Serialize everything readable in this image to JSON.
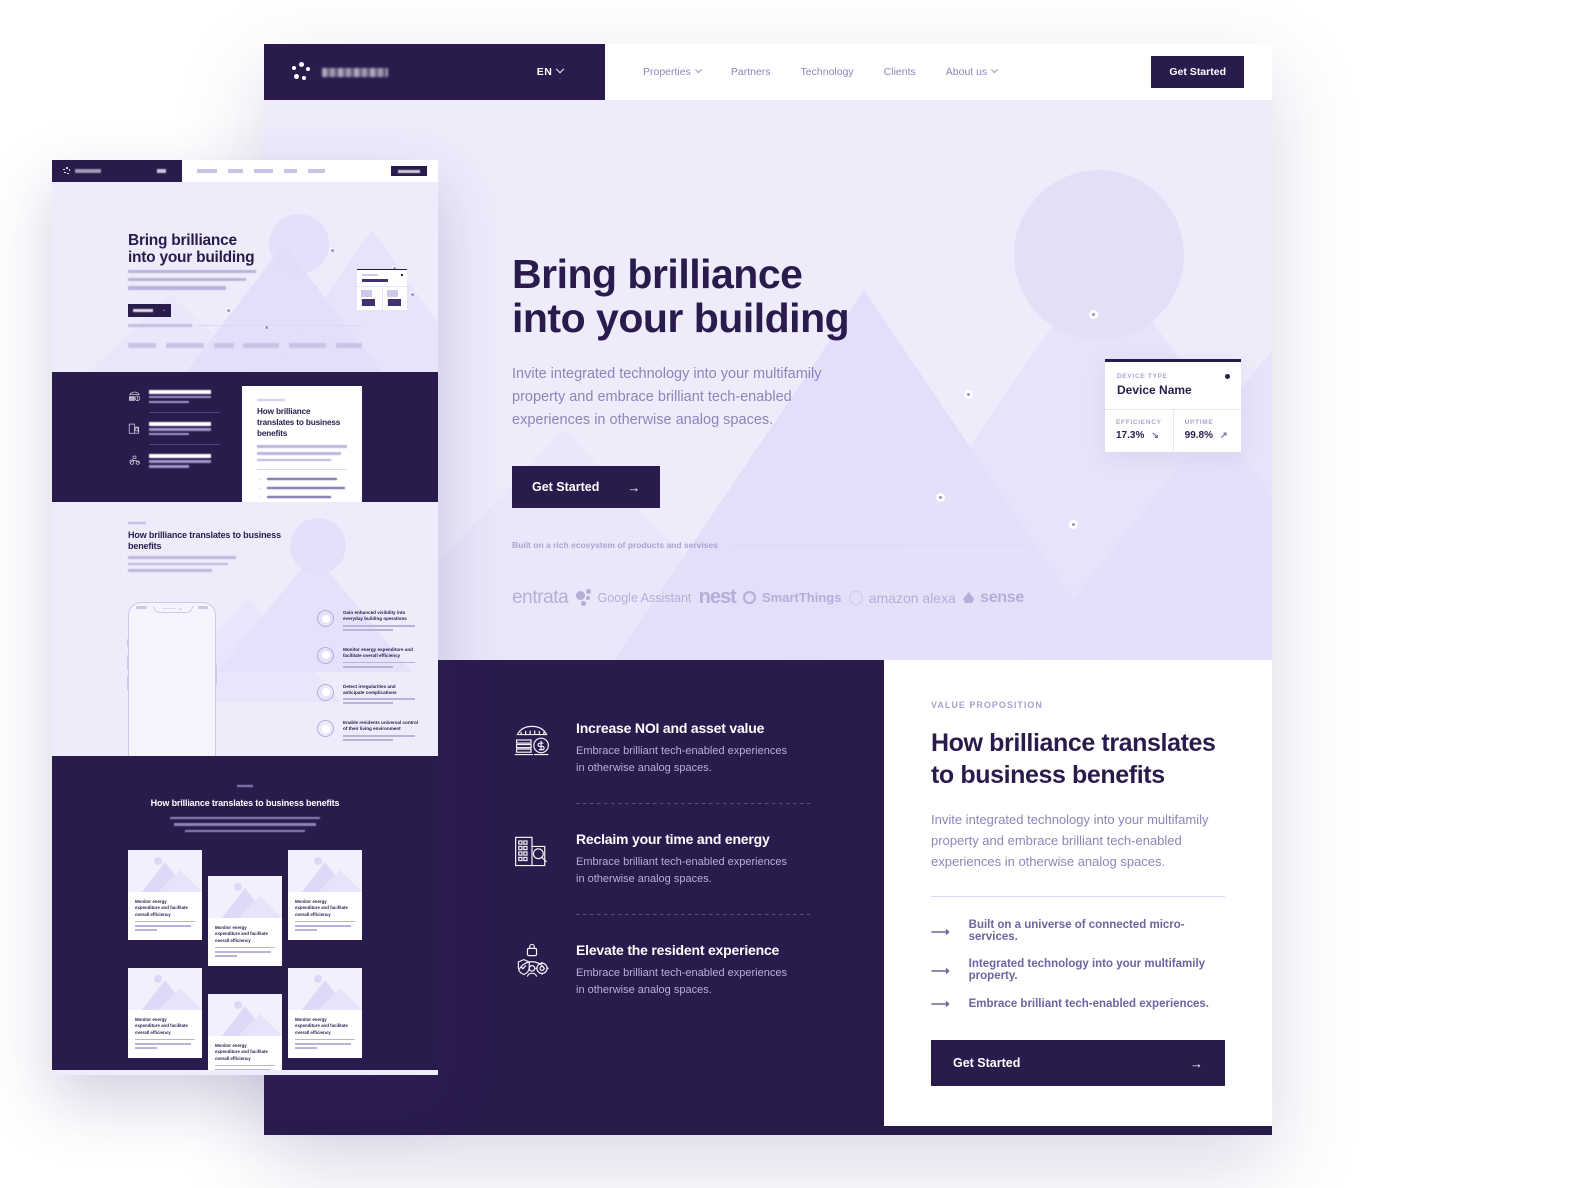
{
  "colors": {
    "navy": "#2a1b4d",
    "lavender_bg": "#eeecfb",
    "muted_text": "#8d85b8",
    "rule": "#ddd8f1",
    "white": "#ffffff"
  },
  "header": {
    "brand_name": "",
    "logo_icon": "dot-cluster-logo-icon",
    "language": "EN",
    "nav": [
      {
        "label": "Properties",
        "has_caret": true
      },
      {
        "label": "Partners",
        "has_caret": false
      },
      {
        "label": "Technology",
        "has_caret": false
      },
      {
        "label": "Clients",
        "has_caret": false
      },
      {
        "label": "About us",
        "has_caret": true
      }
    ],
    "cta_label": "Get Started"
  },
  "hero": {
    "title_line1": "Bring brilliance",
    "title_line2": "into your building",
    "subtitle": "Invite integrated technology into your multifamily property and embrace brilliant tech-enabled experiences in otherwise analog spaces.",
    "cta_label": "Get Started",
    "cta_arrow": "→",
    "device_card": {
      "type_label": "DEVICE TYPE",
      "name": "Device Name",
      "status_led": "status-dot-icon",
      "efficiency_label": "EFFICIENCY",
      "efficiency_value": "17.3%",
      "efficiency_trend": "↘",
      "uptime_label": "UPTIME",
      "uptime_value": "99.8%",
      "uptime_trend": "↗"
    }
  },
  "ecosystem": {
    "heading": "Built on a rich ecosystem of products and servises",
    "logos": [
      {
        "name": "entrata",
        "icon": "entrata-logo-icon"
      },
      {
        "name": "Google Assistant",
        "icon": "google-assistant-logo-icon"
      },
      {
        "name": "nest",
        "icon": "nest-logo-icon"
      },
      {
        "name": "SmartThings",
        "icon": "smartthings-logo-icon"
      },
      {
        "name": "amazon alexa",
        "icon": "amazon-alexa-logo-icon"
      },
      {
        "name": "sense",
        "icon": "sense-logo-icon"
      }
    ]
  },
  "benefits": [
    {
      "icon": "building-money-icon",
      "title": "Increase NOI and asset value",
      "description": "Embrace brilliant tech-enabled experiences in otherwise analog spaces."
    },
    {
      "icon": "building-search-icon",
      "title": "Reclaim your time and energy",
      "description": "Embrace brilliant tech-enabled experiences in otherwise analog spaces."
    },
    {
      "icon": "shield-lock-person-icon",
      "title": "Elevate the resident experience",
      "description": "Embrace brilliant tech-enabled experiences in otherwise analog spaces."
    }
  ],
  "value_proposition": {
    "kicker": "VALUE PROPOSITION",
    "title": "How brilliance translates to business benefits",
    "body": "Invite integrated technology into your multifamily property and embrace brilliant tech-enabled experiences in otherwise analog spaces.",
    "bullets": [
      "Built on a universe of connected micro-services.",
      "Integrated technology into your multifamily property.",
      "Embrace brilliant tech-enabled experiences."
    ],
    "bullet_arrow": "⟶",
    "cta_label": "Get Started",
    "cta_arrow": "→"
  },
  "thumbnail": {
    "hero_title_line1": "Bring brilliance",
    "hero_title_line2": "into your building",
    "vp_title": "How brilliance translates to business benefits",
    "features_title": "How brilliance translates to business benefits",
    "features": [
      {
        "title_line1": "Gain enhanced visibility into",
        "title_line2": "everyday building operations"
      },
      {
        "title_line1": "Monitor energy expenditure and",
        "title_line2": "facilitate overall efficiency"
      },
      {
        "title_line1": "Detect irregularities and",
        "title_line2": "anticipate complications"
      },
      {
        "title_line1": "Enable residents universal control",
        "title_line2": "of their living environment"
      }
    ],
    "grid_title": "How brilliance translates to business benefits",
    "card_title_line1": "Monitor energy",
    "card_title_line2": "expenditure and facilitate",
    "card_title_line3": "overall efficiency"
  }
}
